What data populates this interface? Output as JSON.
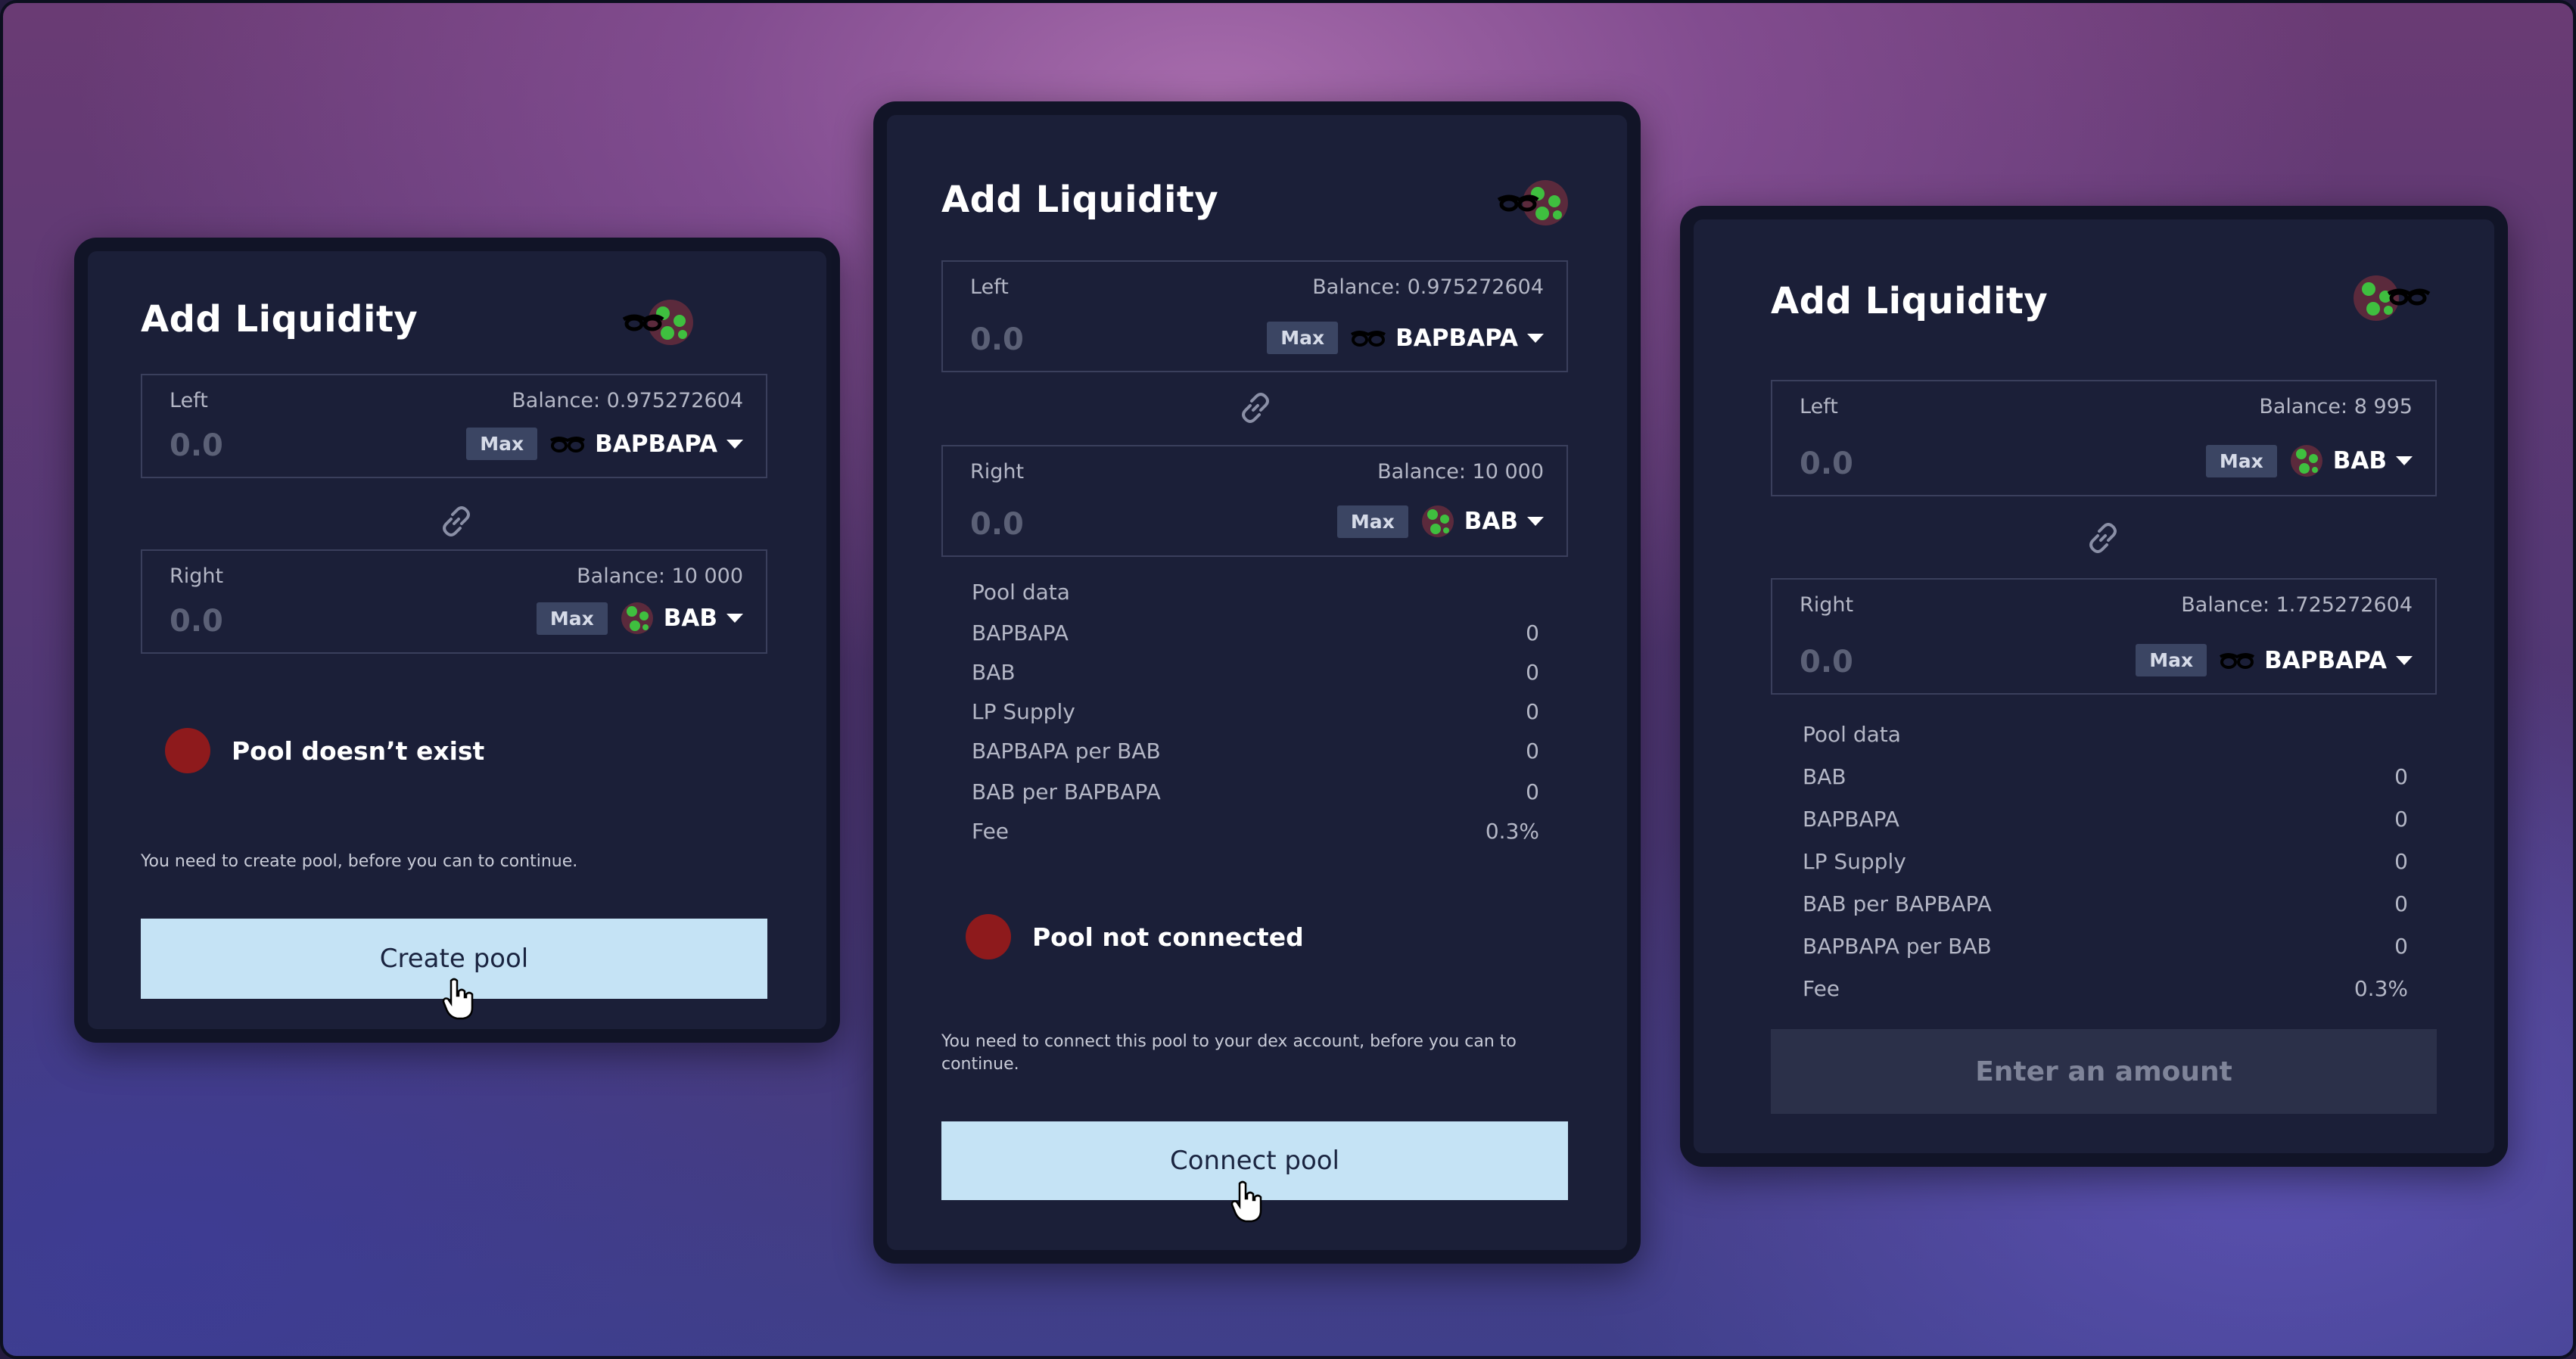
{
  "cards": [
    {
      "title": "Add Liquidity",
      "left": {
        "label": "Left",
        "balance": "Balance: 0.975272604",
        "value": "0.0",
        "max": "Max",
        "token": "BAPBAPA"
      },
      "right": {
        "label": "Right",
        "balance": "Balance: 10 000",
        "value": "0.0",
        "max": "Max",
        "token": "BAB"
      },
      "status": "Pool doesn’t exist",
      "note": "You need to create pool, before you can to continue.",
      "button": "Create pool"
    },
    {
      "title": "Add Liquidity",
      "left": {
        "label": "Left",
        "balance": "Balance: 0.975272604",
        "value": "0.0",
        "max": "Max",
        "token": "BAPBAPA"
      },
      "right": {
        "label": "Right",
        "balance": "Balance: 10 000",
        "value": "0.0",
        "max": "Max",
        "token": "BAB"
      },
      "pool": {
        "heading": "Pool data",
        "rows": [
          {
            "label": "BAPBAPA",
            "value": "0"
          },
          {
            "label": "BAB",
            "value": "0"
          },
          {
            "label": "LP Supply",
            "value": "0"
          },
          {
            "label": "BAPBAPA per BAB",
            "value": "0"
          },
          {
            "label": "BAB per BAPBAPA",
            "value": "0"
          },
          {
            "label": "Fee",
            "value": "0.3%"
          }
        ]
      },
      "status": "Pool not connected",
      "note": "You need to connect this pool to your dex account, before you can to continue.",
      "button": "Connect pool"
    },
    {
      "title": "Add Liquidity",
      "left": {
        "label": "Left",
        "balance": "Balance: 8 995",
        "value": "0.0",
        "max": "Max",
        "token": "BAB"
      },
      "right": {
        "label": "Right",
        "balance": "Balance: 1.725272604",
        "value": "0.0",
        "max": "Max",
        "token": "BAPBAPA"
      },
      "pool": {
        "heading": "Pool data",
        "rows": [
          {
            "label": "BAB",
            "value": "0"
          },
          {
            "label": "BAPBAPA",
            "value": "0"
          },
          {
            "label": "LP Supply",
            "value": "0"
          },
          {
            "label": "BAB per BAPBAPA",
            "value": "0"
          },
          {
            "label": "BAPBAPA per BAB",
            "value": "0"
          },
          {
            "label": "Fee",
            "value": "0.3%"
          }
        ]
      },
      "button": "Enter an amount"
    }
  ],
  "icons": {
    "logo": "token-pair-logo-icon",
    "glasses": "glasses-token-icon",
    "bab": "green-blob-token-icon",
    "link": "link-icon",
    "cursor": "hand-pointer-icon"
  },
  "colors": {
    "card_bg": "#1b1f38",
    "button_active": "#c5e3f5",
    "button_disabled": "#2b3049",
    "status_dot": "#8e1a1c",
    "max_button": "#3b4563"
  }
}
